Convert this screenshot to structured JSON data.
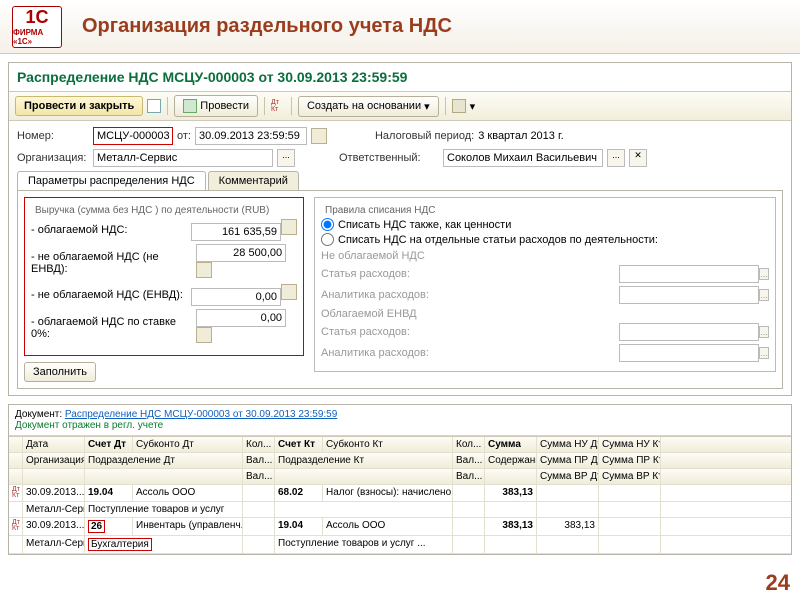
{
  "slide": {
    "title": "Организация раздельного учета НДС",
    "number": "24",
    "logo_top": "1С",
    "logo_bottom": "ФИРМА «1С»"
  },
  "doc": {
    "title": "Распределение НДС МСЦУ-000003 от 30.09.2013 23:59:59",
    "toolbar": {
      "post_close": "Провести и закрыть",
      "post": "Провести",
      "dtKt": "Дт\nКт",
      "create_based": "Создать на основании"
    },
    "fields": {
      "number_lbl": "Номер:",
      "number": "МСЦУ-000003",
      "date_lbl": "от:",
      "date": "30.09.2013 23:59:59",
      "tax_period_lbl": "Налоговый период:",
      "tax_period": "3 квартал 2013 г.",
      "org_lbl": "Организация:",
      "org": "Металл-Сервис",
      "resp_lbl": "Ответственный:",
      "resp": "Соколов Михаил Васильевич"
    },
    "tabs": {
      "params": "Параметры распределения НДС",
      "comment": "Комментарий"
    },
    "revenue": {
      "title": "Выручка (сумма без НДС ) по деятельности (RUB)",
      "r1_lbl": "- облагаемой НДС:",
      "r1": "161 635,59",
      "r2_lbl": "- не облагаемой НДС (не ЕНВД):",
      "r2": "28 500,00",
      "r3_lbl": "- не облагаемой НДС (ЕНВД):",
      "r3": "0,00",
      "r4_lbl": "- облагаемой НДС по ставке 0%:",
      "r4": "0,00",
      "fill": "Заполнить"
    },
    "rules": {
      "title": "Правила списания НДС",
      "opt1": "Списать НДС также, как ценности",
      "opt2": "Списать НДС на отдельные статьи расходов по деятельности:",
      "sec1": "Не облагаемой НДС",
      "exp_item_lbl": "Статья расходов:",
      "analytics_lbl": "Аналитика расходов:",
      "sec2": "Облагаемой ЕНВД"
    }
  },
  "ledger": {
    "doc_lbl": "Документ:",
    "doc_link": "Распределение НДС МСЦУ-000003 от 30.09.2013 23:59:59",
    "status": "Документ отражен в регл. учете",
    "h": {
      "date": "Дата",
      "acc_dt": "Счет Дт",
      "sub_dt": "Субконто Дт",
      "qty": "Кол...",
      "acc_kt": "Счет Кт",
      "sub_kt": "Субконто Кт",
      "sum": "Сумма",
      "nu_dt": "Сумма НУ Дт",
      "nu_kt": "Сумма НУ Кт",
      "org": "Организация",
      "dept_dt": "Подразделение Дт",
      "val": "Вал...",
      "dept_kt": "Подразделение Кт",
      "content": "Содержание",
      "pr_dt": "Сумма ПР Дт",
      "pr_kt": "Сумма ПР Кт",
      "vr_dt": "Сумма ВР Дт",
      "vr_kt": "Сумма ВР Кт"
    },
    "rows": [
      {
        "date": "30.09.2013...",
        "acc_dt": "19.04",
        "sub_dt": "Ассоль ООО",
        "acc_kt": "68.02",
        "sub_kt": "Налог (взносы): начислено / уп...",
        "sum": "383,13",
        "org": "Металл-Серв",
        "sub_dt2": "Поступление товаров и услуг"
      },
      {
        "date": "30.09.2013...",
        "acc_dt": "26",
        "sub_dt": "Инвентарь (управленч.)",
        "acc_kt": "19.04",
        "sub_kt": "Ассоль ООО",
        "sum": "383,13",
        "nu_dt": "383,13",
        "org": "Металл-Серв",
        "dept_dt": "Бухгалтерия",
        "sub_kt2": "Поступление товаров и услуг ..."
      }
    ]
  }
}
